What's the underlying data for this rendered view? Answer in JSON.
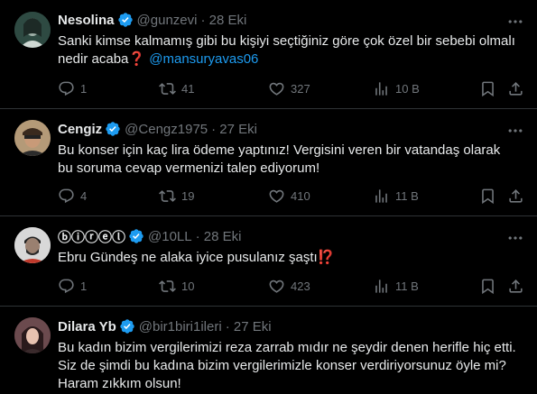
{
  "tweets": [
    {
      "name": "Nesolina",
      "handle": "@gunzevi",
      "date": "· 28 Eki",
      "text": "Sanki kimse kalmamış gibi bu kişiyi seçtiğiniz göre çok özel bir sebebi olmalı nedir acaba",
      "emoji": "❓",
      "mention": "@mansuryavas06",
      "replies": "1",
      "retweets": "41",
      "likes": "327",
      "views": "10 B",
      "avatar_color": "#2f4a43"
    },
    {
      "name": "Cengiz",
      "handle": "@Cengz1975",
      "date": "· 27 Eki",
      "text_line1": "Bu konser için kaç lira ödeme yaptınız! Vergisini veren bir vatandaş olarak",
      "text_line2": "bu soruma cevap vermenizi talep ediyorum!",
      "replies": "4",
      "retweets": "19",
      "likes": "410",
      "views": "11 B",
      "avatar_color": "#6b5a44"
    },
    {
      "name": "ⓑⓘⓡⓔⓛ",
      "handle": "@10LL",
      "date": "· 28 Eki",
      "text": "Ebru Gündeş ne alaka iyice pusulanız şaştı",
      "emoji": "⁉️",
      "replies": "1",
      "retweets": "10",
      "likes": "423",
      "views": "11 B",
      "avatar_color": "#cfcfcf"
    },
    {
      "name": "Dilara Yb",
      "handle": "@bir1biri1ileri",
      "date": "· 27 Eki",
      "text_line1": "Bu kadın bizim vergilerimizi reza zarrab mıdır ne şeydir denen herifle hiç etti.",
      "text_line2": "Siz de şimdi bu kadına bizim vergilerimizle konser verdiriyorsunuz öyle mi?",
      "text_line3": "Haram zıkkım olsun!",
      "avatar_color": "#5a3a3e"
    }
  ],
  "colors": {
    "accent": "#1d9bf0",
    "muted": "#71767b",
    "text": "#e7e9ea",
    "divider": "#2f3336"
  },
  "icons": [
    "reply-icon",
    "retweet-icon",
    "like-icon",
    "views-icon",
    "bookmark-icon",
    "share-icon",
    "more-icon",
    "verified-icon"
  ]
}
